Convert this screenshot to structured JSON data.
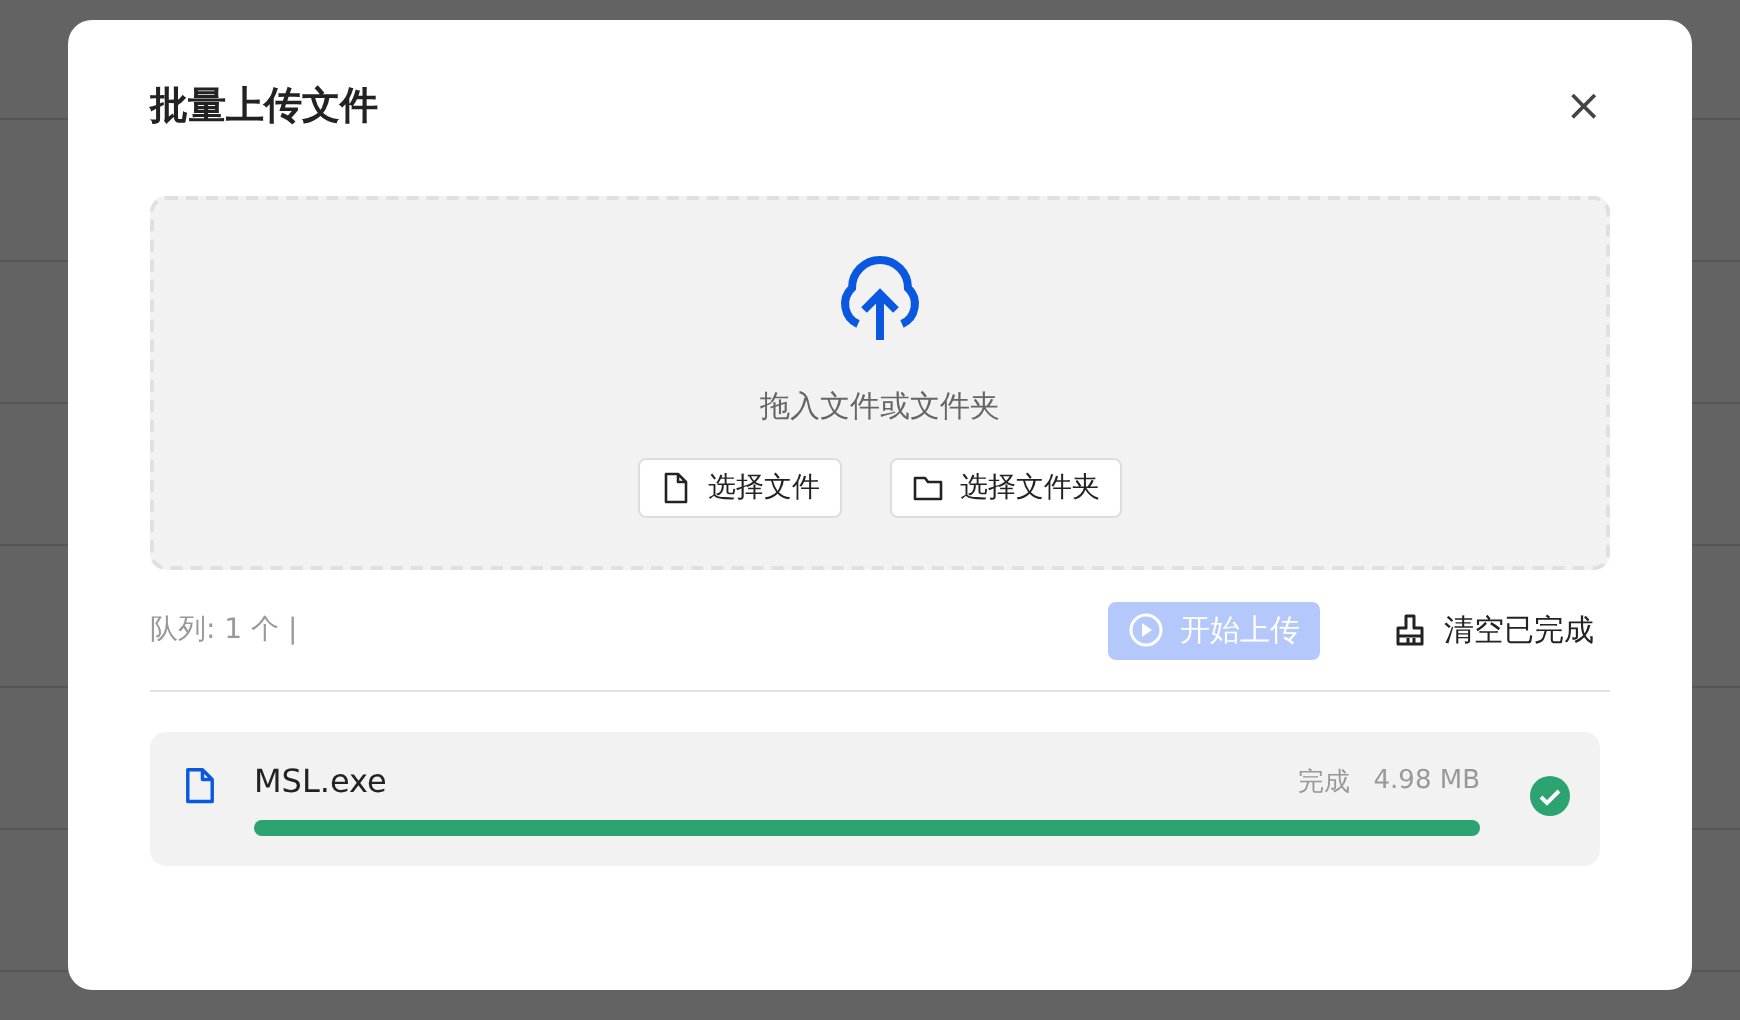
{
  "dialog": {
    "title": "批量上传文件",
    "close": "×"
  },
  "dropzone": {
    "hint": "拖入文件或文件夹",
    "buttons": [
      {
        "kind": "file",
        "label": "选择文件"
      },
      {
        "kind": "folder",
        "label": "选择文件夹"
      }
    ]
  },
  "toolbar": {
    "queue": "队列: 1 个 |",
    "start": {
      "label": "开始上传",
      "disabled": true
    },
    "clear": {
      "label": "清空已完成"
    }
  },
  "files": [
    {
      "name": "MSL.exe",
      "status": "完成",
      "size": "4.98 MB",
      "level": 1,
      "done": true
    }
  ]
}
